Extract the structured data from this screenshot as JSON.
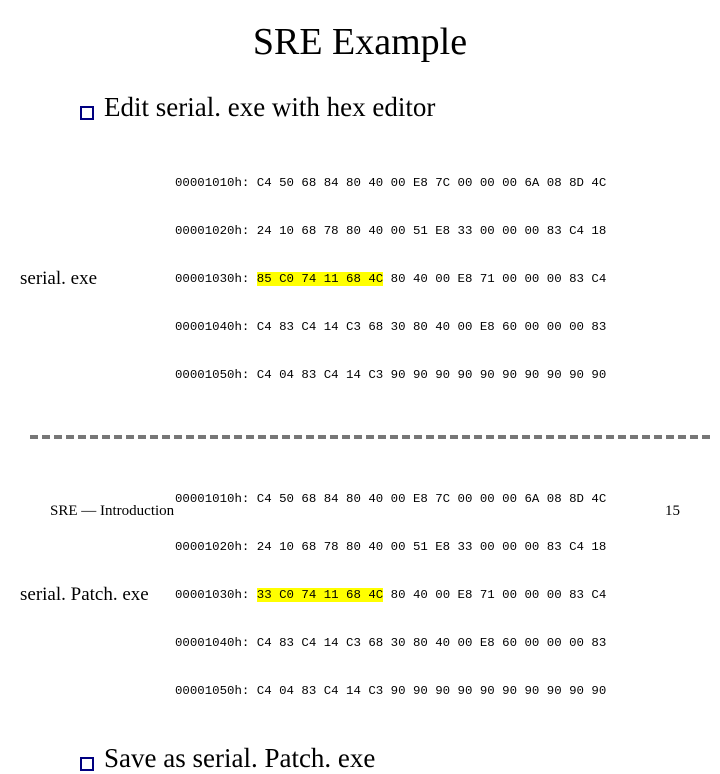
{
  "title": "SRE Example",
  "bullet1": "Edit serial. exe with hex editor",
  "bullet2": "Save as serial. Patch. exe",
  "label_top": "serial. exe",
  "label_bottom": "serial. Patch. exe",
  "hex_common": {
    "r1": "00001010h: C4 50 68 84 80 40 00 E8 7C 00 00 00 6A 08 8D 4C",
    "r2": "00001020h: 24 10 68 78 80 40 00 51 E8 33 00 00 00 83 C4 18",
    "r4": "00001040h: C4 83 C4 14 C3 68 30 80 40 00 E8 60 00 00 00 83",
    "r5": "00001050h: C4 04 83 C4 14 C3 90 90 90 90 90 90 90 90 90 90"
  },
  "hex_top_r3": {
    "addr": "00001030h:",
    "hl": "85 C0 74 11 68 4C",
    "rest": " 80 40 00 E8 71 00 00 00 83 C4"
  },
  "hex_bot_r3": {
    "addr": "00001030h:",
    "hl": "33 C0 74 11 68 4C",
    "rest": " 80 40 00 E8 71 00 00 00 83 C4"
  },
  "footer_left": "SRE — Introduction",
  "footer_right": "15"
}
